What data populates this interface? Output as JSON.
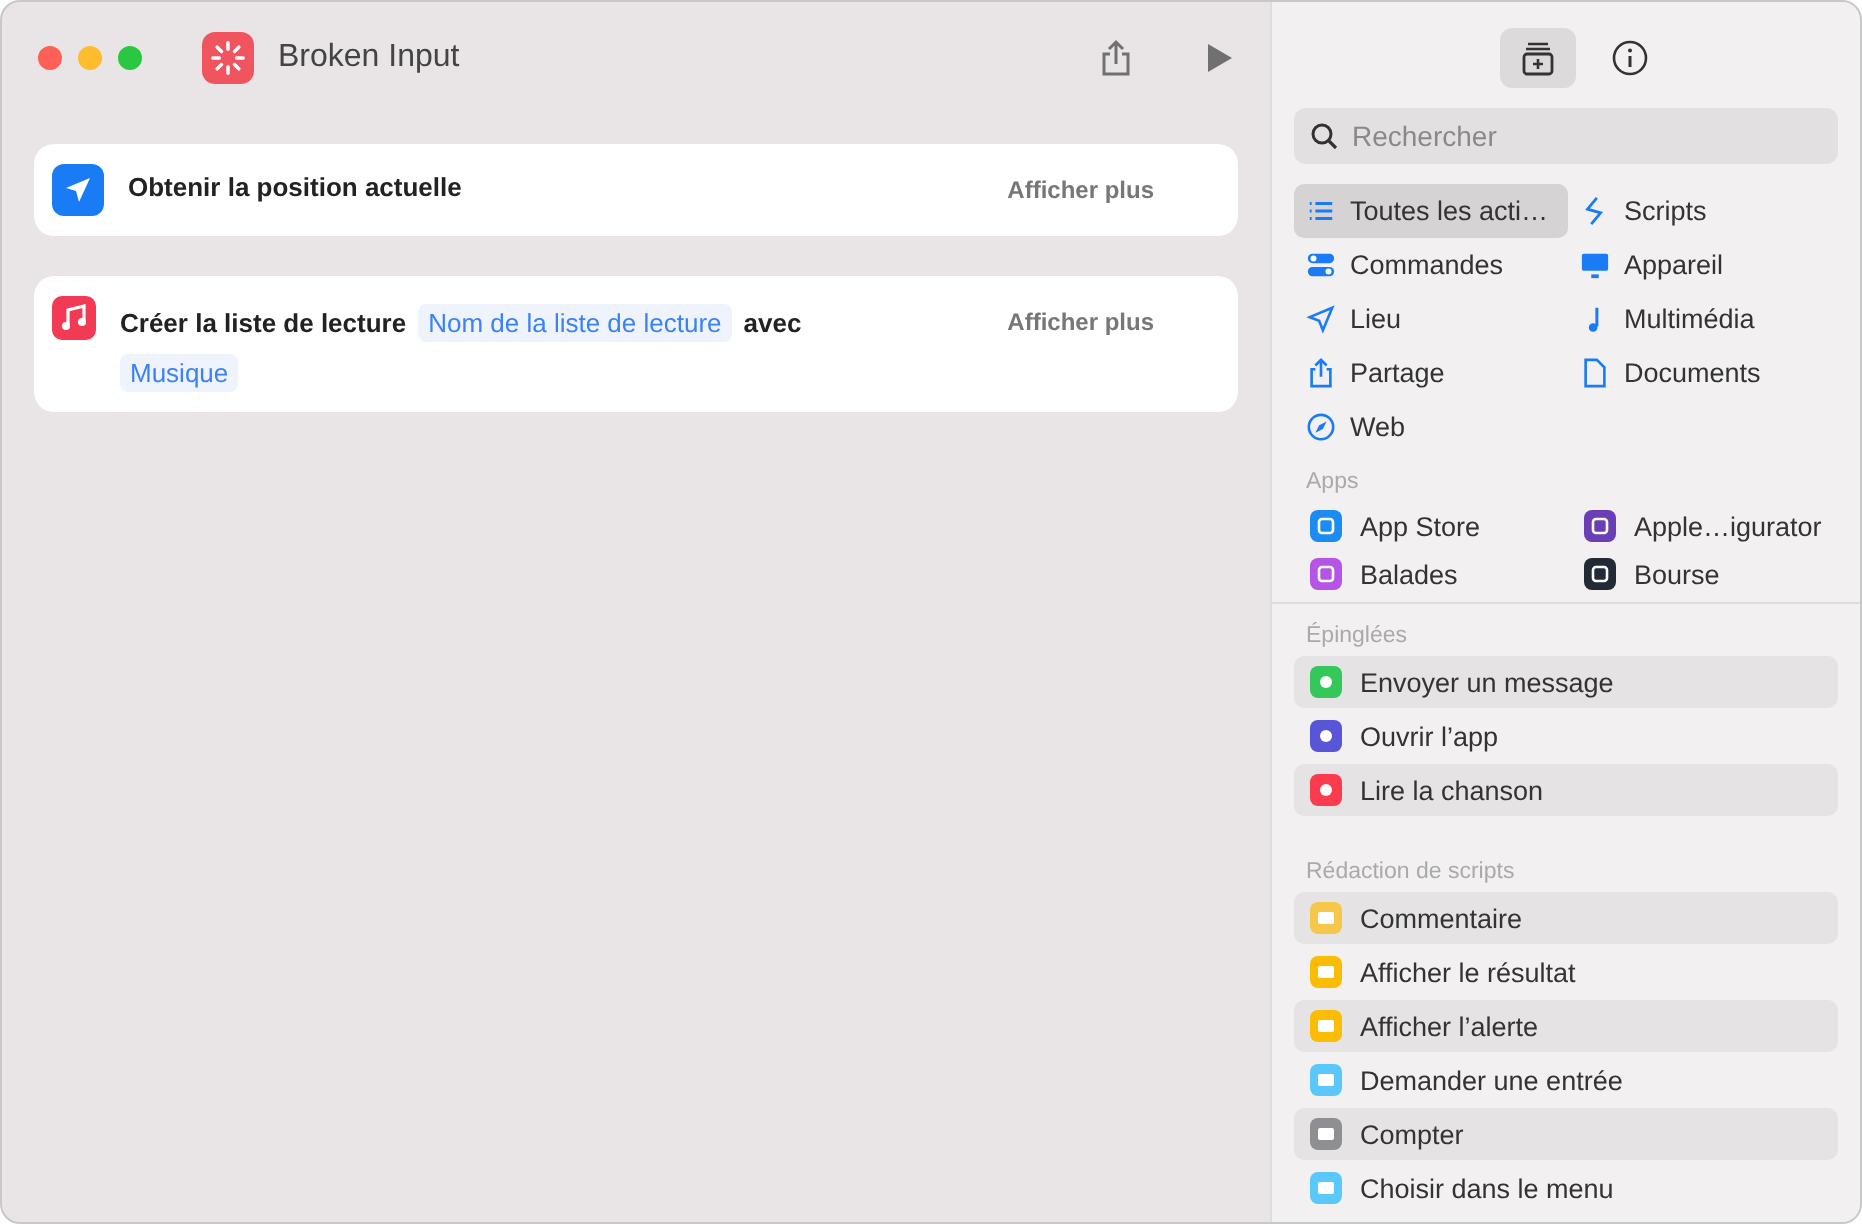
{
  "window": {
    "title": "Broken Input"
  },
  "actions": [
    {
      "kind": "location",
      "title": "Obtenir la position actuelle",
      "more": "Afficher plus"
    },
    {
      "kind": "playlist",
      "title": "Créer la liste de lecture",
      "token": "Nom de la liste de lecture",
      "connector": "avec",
      "second_token": "Musique",
      "more": "Afficher plus"
    }
  ],
  "sidebar": {
    "tabs": [
      {
        "kind": "library",
        "selected": true
      },
      {
        "kind": "info",
        "selected": false
      }
    ],
    "search": {
      "placeholder": "Rechercher"
    },
    "categories": [
      {
        "label": "Toutes les acti…",
        "selected": true
      },
      {
        "label": "Scripts",
        "selected": false
      },
      {
        "label": "Commandes",
        "selected": false
      },
      {
        "label": "Appareil",
        "selected": false
      },
      {
        "label": "Lieu",
        "selected": false
      },
      {
        "label": "Multimédia",
        "selected": false
      },
      {
        "label": "Partage",
        "selected": false
      },
      {
        "label": "Documents",
        "selected": false
      },
      {
        "label": "Web",
        "selected": false
      }
    ],
    "apps_heading": "Apps",
    "apps": [
      {
        "label": "App Store",
        "color": "#1d8cf2"
      },
      {
        "label": "Apple…igurator",
        "color": "#6a3fb5"
      },
      {
        "label": "Balades",
        "color": "#b455e6"
      },
      {
        "label": "Bourse",
        "color": "#222a35"
      }
    ],
    "pinned_heading": "Épinglées",
    "pinned": [
      {
        "label": "Envoyer un message",
        "color": "#34c759"
      },
      {
        "label": "Ouvrir l’app",
        "color": "#5856d6"
      },
      {
        "label": "Lire la chanson",
        "color": "#fa3c4e"
      }
    ],
    "scripting_heading": "Rédaction de scripts",
    "scripting": [
      {
        "label": "Commentaire",
        "color": "#f5c84c"
      },
      {
        "label": "Afficher le résultat",
        "color": "#fbbc05"
      },
      {
        "label": "Afficher l’alerte",
        "color": "#fbbc05"
      },
      {
        "label": "Demander une entrée",
        "color": "#5ac8fa"
      },
      {
        "label": "Compter",
        "color": "#8e8e93"
      },
      {
        "label": "Choisir dans le menu",
        "color": "#5ac8fa"
      }
    ]
  }
}
